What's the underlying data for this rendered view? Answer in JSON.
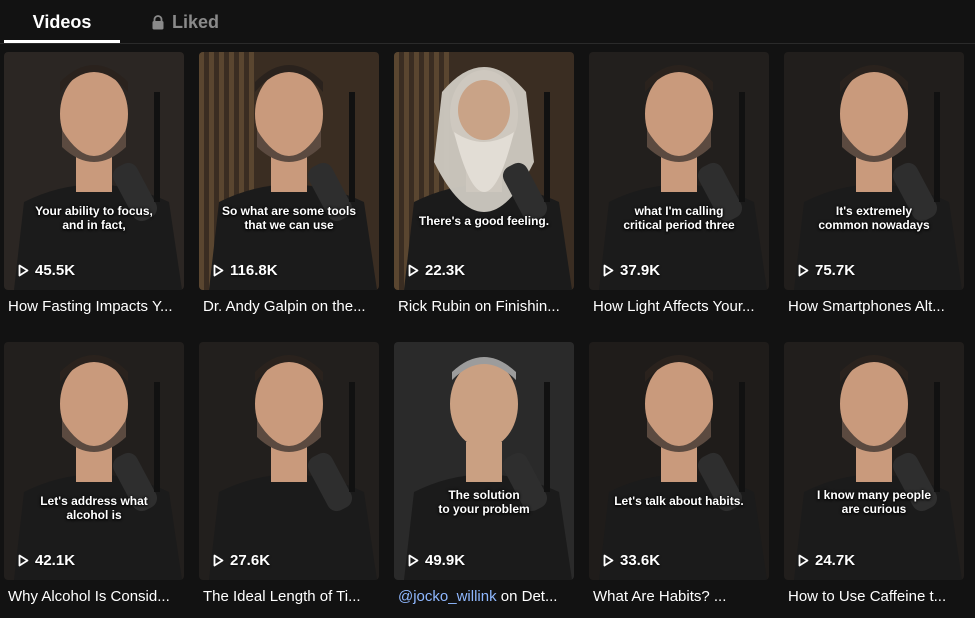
{
  "tabs": {
    "videos": "Videos",
    "liked": "Liked"
  },
  "icons": {
    "liked_lock": "lock-icon",
    "views": "play-icon"
  },
  "videos": [
    {
      "views": "45.5K",
      "caption1": "Your ability to focus,",
      "caption2": "and in fact,",
      "title": "How Fasting Impacts Y...",
      "person": "huberman",
      "bg": "#2b2623"
    },
    {
      "views": "116.8K",
      "caption1": "So what are some tools",
      "caption2": "that we can use",
      "title": "Dr. Andy Galpin on the...",
      "person": "galpin",
      "bg": "#3a2d22"
    },
    {
      "views": "22.3K",
      "caption1": "There's a good feeling.",
      "caption2": "",
      "title": "Rick Rubin on Finishin...",
      "person": "rubin",
      "bg": "#3a2d22"
    },
    {
      "views": "37.9K",
      "caption1": "what I'm calling",
      "caption2": "critical period three",
      "title": "How Light Affects Your...",
      "person": "huberman",
      "bg": "#221f1d"
    },
    {
      "views": "75.7K",
      "caption1": "It's extremely",
      "caption2": "common nowadays",
      "title": "How Smartphones Alt...",
      "person": "huberman",
      "bg": "#211e1c"
    },
    {
      "views": "42.1K",
      "caption1": "Let's address what alcohol is",
      "caption2": "",
      "title": "Why Alcohol Is Consid...",
      "person": "huberman",
      "bg": "#221f1d"
    },
    {
      "views": "27.6K",
      "caption1": "",
      "caption2": "",
      "title": "The Ideal Length of Ti...",
      "person": "huberman",
      "bg": "#221f1d"
    },
    {
      "views": "49.9K",
      "caption1": "The solution",
      "caption2": "to your problem",
      "title_mention": "@jocko_willink",
      "title_rest": " on Det...",
      "person": "jocko",
      "bg": "#2a2a2a"
    },
    {
      "views": "33.6K",
      "caption1": "Let's talk about habits.",
      "caption2": "",
      "title": "What Are Habits? ...",
      "person": "huberman",
      "bg": "#1f1c1a"
    },
    {
      "views": "24.7K",
      "caption1": "I know many people",
      "caption2": "are curious",
      "title": "How to Use Caffeine t...",
      "person": "huberman",
      "bg": "#211e1c"
    }
  ]
}
